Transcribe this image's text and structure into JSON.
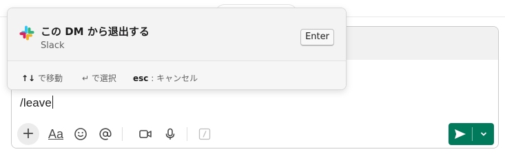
{
  "command": {
    "title": "この DM から退出する",
    "source": "Slack",
    "key_hint": "Enter"
  },
  "hints": {
    "move_keys": "↑↓",
    "move_label": "で移動",
    "select_key": "↵",
    "select_label": "で選択",
    "cancel_key": "esc",
    "cancel_label": ": キャンセル"
  },
  "composer": {
    "input_value": "/leave"
  },
  "toolbar": {
    "plus": "+",
    "format": "Aa"
  },
  "icons": [
    "slack-logo-icon",
    "plus-icon",
    "text-format-icon",
    "emoji-icon",
    "mention-icon",
    "video-icon",
    "microphone-icon",
    "slash-command-icon",
    "send-icon",
    "chevron-down-icon"
  ],
  "colors": {
    "send": "#007a5a",
    "slack_blue": "#36c5f0",
    "slack_green": "#2eb67d",
    "slack_yellow": "#ecb22e",
    "slack_red": "#e01e5a"
  }
}
